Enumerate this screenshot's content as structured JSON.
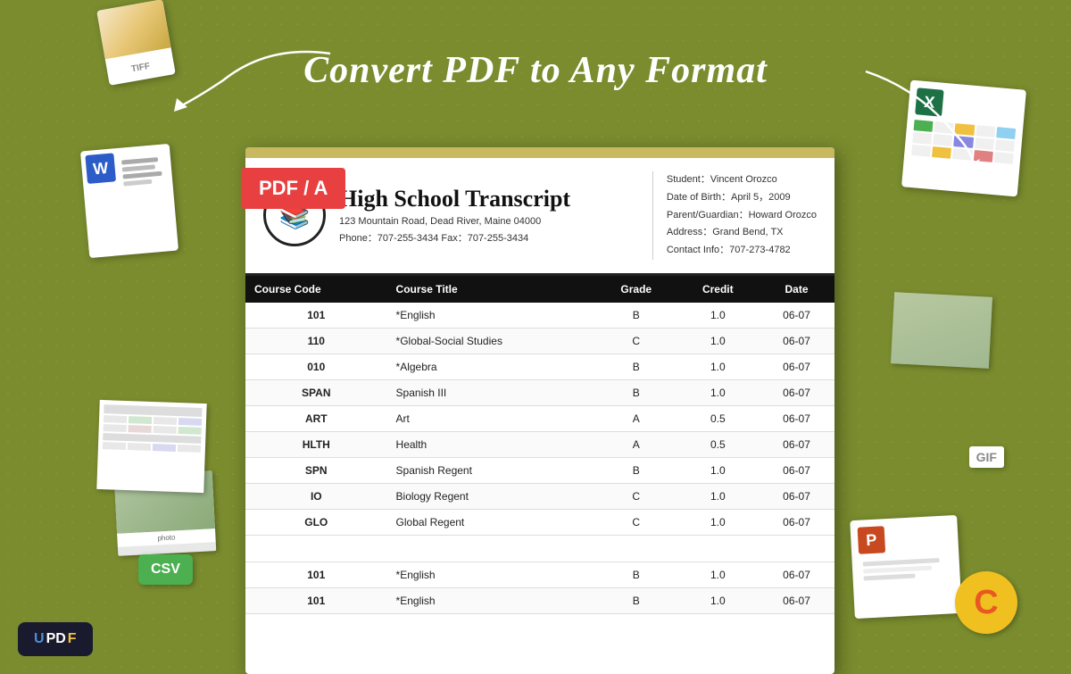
{
  "page": {
    "background_color": "#7a8c2e",
    "headline": "Convert PDF to Any Format"
  },
  "pdf_badge": {
    "label": "PDF / A"
  },
  "document": {
    "top_bar_color": "#c8b860",
    "logo_icon": "📚",
    "title": "High School Transcript",
    "address_line1": "123 Mountain Road, Dead River, Maine 04000",
    "phone_fax": "Phone：707-255-3434    Fax：707-255-3434",
    "student_name": "Student：Vincent Orozco",
    "dob": "Date of Birth：April 5，2009",
    "parent": "Parent/Guardian：Howard Orozco",
    "address": "Address：Grand Bend, TX",
    "contact": "Contact Info：707-273-4782"
  },
  "table": {
    "headers": [
      "Course Code",
      "Course Title",
      "Grade",
      "Credit",
      "Date"
    ],
    "rows": [
      {
        "code": "101",
        "title": "*English",
        "grade": "B",
        "credit": "1.0",
        "date": "06-07"
      },
      {
        "code": "110",
        "title": "*Global-Social Studies",
        "grade": "C",
        "credit": "1.0",
        "date": "06-07"
      },
      {
        "code": "010",
        "title": "*Algebra",
        "grade": "B",
        "credit": "1.0",
        "date": "06-07"
      },
      {
        "code": "SPAN",
        "title": "Spanish III",
        "grade": "B",
        "credit": "1.0",
        "date": "06-07"
      },
      {
        "code": "ART",
        "title": "Art",
        "grade": "A",
        "credit": "0.5",
        "date": "06-07"
      },
      {
        "code": "HLTH",
        "title": "Health",
        "grade": "A",
        "credit": "0.5",
        "date": "06-07"
      },
      {
        "code": "SPN",
        "title": "Spanish Regent",
        "grade": "B",
        "credit": "1.0",
        "date": "06-07"
      },
      {
        "code": "IO",
        "title": "Biology Regent",
        "grade": "C",
        "credit": "1.0",
        "date": "06-07"
      },
      {
        "code": "GLO",
        "title": "Global Regent",
        "grade": "C",
        "credit": "1.0",
        "date": "06-07"
      },
      {
        "spacer": true
      },
      {
        "code": "101",
        "title": "*English",
        "grade": "B",
        "credit": "1.0",
        "date": "06-07"
      },
      {
        "code": "101",
        "title": "*English",
        "grade": "B",
        "credit": "1.0",
        "date": "06-07"
      }
    ]
  },
  "decorations": {
    "tiff_label": "TIFF",
    "word_label": "W",
    "excel_label": "X",
    "csv_label": "CSV",
    "updf_label": "UPDF",
    "ppt_label": "P",
    "c_label": "C",
    "gif_label": "GIF"
  }
}
